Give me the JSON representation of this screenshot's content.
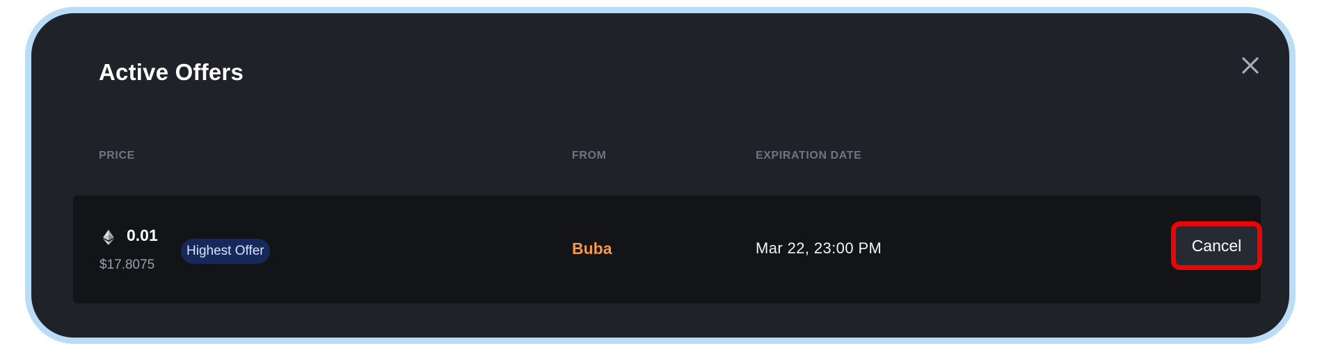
{
  "modal": {
    "title": "Active Offers",
    "close_icon": "close-icon"
  },
  "table": {
    "columns": {
      "price": "PRICE",
      "from": "FROM",
      "expiration": "EXPIRATION DATE"
    },
    "rows": [
      {
        "currency_icon": "ethereum-icon",
        "price_eth": "0.01",
        "price_usd": "$17.8075",
        "badge": "Highest Offer",
        "from": "Buba",
        "expiration": "Mar 22, 23:00 PM",
        "action_label": "Cancel"
      }
    ]
  },
  "colors": {
    "modal_bg": "#20222a",
    "row_bg": "#131418",
    "frame_border": "#b9dcf7",
    "from_accent": "#f2974c",
    "badge_bg": "#16295a",
    "highlight": "#e70707"
  }
}
